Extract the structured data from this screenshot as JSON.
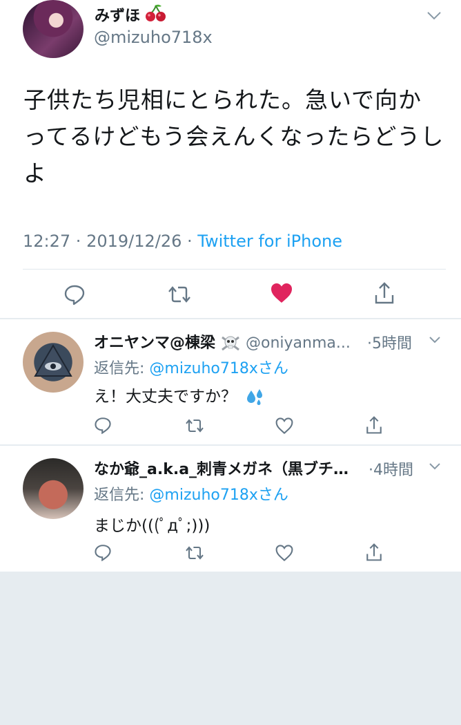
{
  "main_tweet": {
    "display_name": "みずほ",
    "name_emoji": "cherries-emoji",
    "handle": "@mizuho718x",
    "text": "子供たち児相にとられた。急いで向かってるけどもう会えんくなったらどうしよ",
    "time": "12:27",
    "date": "2019/12/26",
    "sep": " · ",
    "source": "Twitter for iPhone",
    "liked": true,
    "colors": {
      "like": "#e0245e",
      "link": "#1da1f2",
      "muted": "#657786"
    }
  },
  "replies": [
    {
      "display_name": "オニヤンマ@棟梁",
      "name_emoji": "skull-crossbones-emoji",
      "handle": "@oniyanma...",
      "time": "5時間",
      "reply_prefix": "返信先: ",
      "reply_to": "@mizuho718x",
      "reply_suffix": "さん",
      "text": "え！大丈夫ですか？",
      "text_emoji": "sweat-droplets-emoji"
    },
    {
      "display_name": "なか爺_a.k.a_刺青メガネ（黒ブチ…",
      "handle": "",
      "time": "4時間",
      "reply_prefix": "返信先: ",
      "reply_to": "@mizuho718x",
      "reply_suffix": "さん",
      "text": "まじか(((ﾟдﾟ;)))"
    }
  ]
}
